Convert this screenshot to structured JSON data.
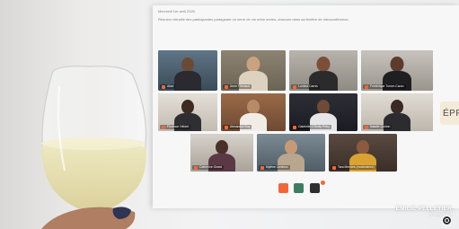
{
  "screen": {
    "date_line": "Mercredi 1er avril 2020",
    "description": "Réunion virtuelle des participantes partageant un verre de vin entre amies, chacune dans sa fenêtre de visioconférence.",
    "participants_row1": [
      {
        "name": "Alice",
        "icon": "mic-muted-icon"
      },
      {
        "name": "Anne Thériault",
        "icon": "mic-muted-icon"
      },
      {
        "name": "Lumina Carnis",
        "icon": "mic-muted-icon"
      },
      {
        "name": "Frédérique Turner-Caron",
        "icon": "mic-muted-icon"
      }
    ],
    "participants_row2": [
      {
        "name": "Florence Hébert",
        "icon": "mic-muted-icon"
      },
      {
        "name": "Alexandra Roy",
        "icon": "mic-muted-icon"
      },
      {
        "name": "Gabrielle O'Reilly Petry",
        "icon": "mic-muted-icon"
      },
      {
        "name": "Natalie Quirion",
        "icon": "mic-muted-icon"
      }
    ],
    "participants_row3": [
      {
        "name": "Catherine Girard",
        "icon": "mic-muted-icon"
      },
      {
        "name": "Mylène Lemieux",
        "icon": "mic-muted-icon"
      },
      {
        "name": "Tara Mendes (moderatrice)",
        "icon": "mic-muted-icon"
      }
    ],
    "controls": [
      {
        "name": "video-camera-icon",
        "color": "#f0683a"
      },
      {
        "name": "microphone-icon",
        "color": "#3f7d62"
      },
      {
        "name": "chat-icon",
        "color": "#2f2f2f"
      }
    ]
  },
  "side_tab": {
    "label": "ÉPP"
  },
  "watermark": {
    "name": "ÉMILIE PELLETIER",
    "subtitle": "Photographe",
    "logo_icon": "camera-lens-icon"
  },
  "colors": {
    "accent": "#f0683a",
    "wine": "#e8e2b4",
    "screen_bg": "#f7f7f8"
  }
}
